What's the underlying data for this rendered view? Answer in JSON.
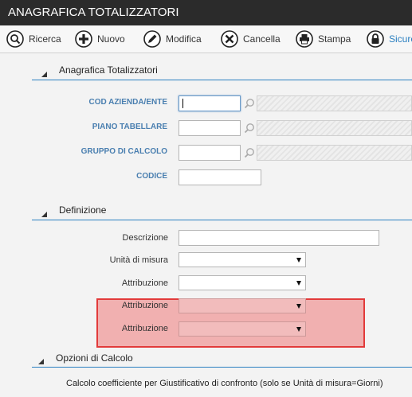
{
  "window": {
    "title": "ANAGRAFICA TOTALIZZATORI"
  },
  "toolbar": {
    "ricerca": "Ricerca",
    "nuovo": "Nuovo",
    "modifica": "Modifica",
    "cancella": "Cancella",
    "stampa": "Stampa",
    "sicurezza": "Sicure"
  },
  "sections": {
    "anagrafica": "Anagrafica Totalizzatori",
    "definizione": "Definizione",
    "opzioni": "Opzioni di Calcolo"
  },
  "anagrafica_fields": {
    "cod_azienda": {
      "label": "COD AZIENDA/ENTE",
      "value": ""
    },
    "piano_tabellare": {
      "label": "PIANO TABELLARE",
      "value": ""
    },
    "gruppo_calcolo": {
      "label": "GRUPPO DI CALCOLO",
      "value": ""
    },
    "codice": {
      "label": "CODICE",
      "value": ""
    }
  },
  "definizione_fields": {
    "descrizione": {
      "label": "Descrizione",
      "value": ""
    },
    "unita_misura": {
      "label": "Unità di misura",
      "value": ""
    },
    "attribuzione_1": {
      "label": "Attribuzione",
      "value": ""
    },
    "attribuzione_2": {
      "label": "Attribuzione",
      "value": ""
    },
    "attribuzione_3": {
      "label": "Attribuzione",
      "value": ""
    }
  },
  "opzioni": {
    "calcolo_coefficiente": "Calcolo coefficiente per Giustificativo di confronto (solo se Unità di misura=Giorni)"
  },
  "colors": {
    "accent": "#2a7fc0",
    "highlight_border": "#e23a3a",
    "titlebar": "#2b2b2b"
  }
}
